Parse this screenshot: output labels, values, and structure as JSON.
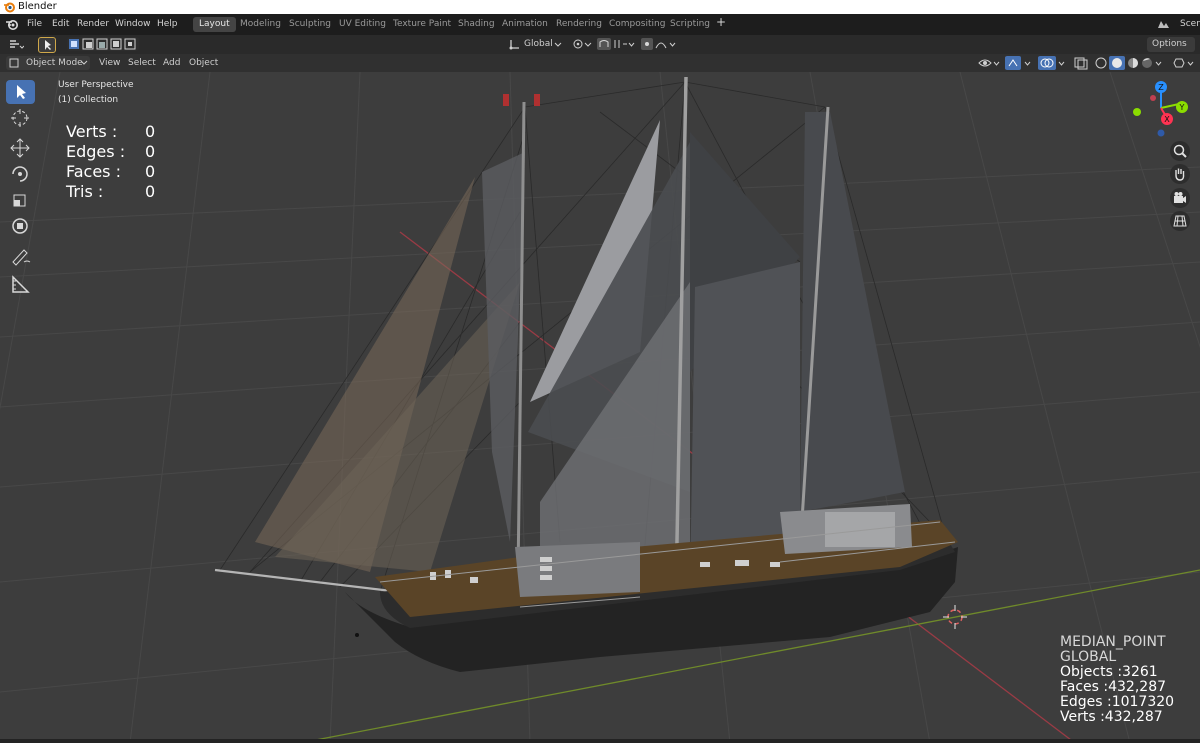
{
  "window": {
    "title": "Blender"
  },
  "menu": {
    "items": [
      "File",
      "Edit",
      "Render",
      "Window",
      "Help"
    ]
  },
  "workspaces": {
    "tabs": [
      "Layout",
      "Modeling",
      "Sculpting",
      "UV Editing",
      "Texture Paint",
      "Shading",
      "Animation",
      "Rendering",
      "Compositing",
      "Scripting"
    ],
    "active": "Layout",
    "add_label": "+",
    "scene_label": "Scen"
  },
  "tool_header": {
    "orientation": "Global",
    "options_label": "Options"
  },
  "viewport_header": {
    "mode": "Object Mode",
    "menus": [
      "View",
      "Select",
      "Add",
      "Object"
    ]
  },
  "viewport": {
    "perspective_label": "User Perspective",
    "collection_label": "(1) Collection",
    "stats": [
      {
        "label": "Verts :",
        "value": "0"
      },
      {
        "label": "Edges :",
        "value": "0"
      },
      {
        "label": "Faces :",
        "value": "0"
      },
      {
        "label": "Tris :",
        "value": "0"
      }
    ],
    "info_lines": [
      "MEDIAN_POINT",
      "GLOBAL",
      "Objects :3261",
      "Faces :432,287",
      "Edges :1017320",
      "Verts :432,287"
    ]
  },
  "gizmo": {
    "z_label": "Z",
    "y_label": "Y",
    "x_label": "X"
  },
  "colors": {
    "active_blue": "#4772b3",
    "axis_x": "#ff3352",
    "axis_y": "#8bdc00",
    "axis_z": "#2890ff",
    "grid": "#474747"
  }
}
